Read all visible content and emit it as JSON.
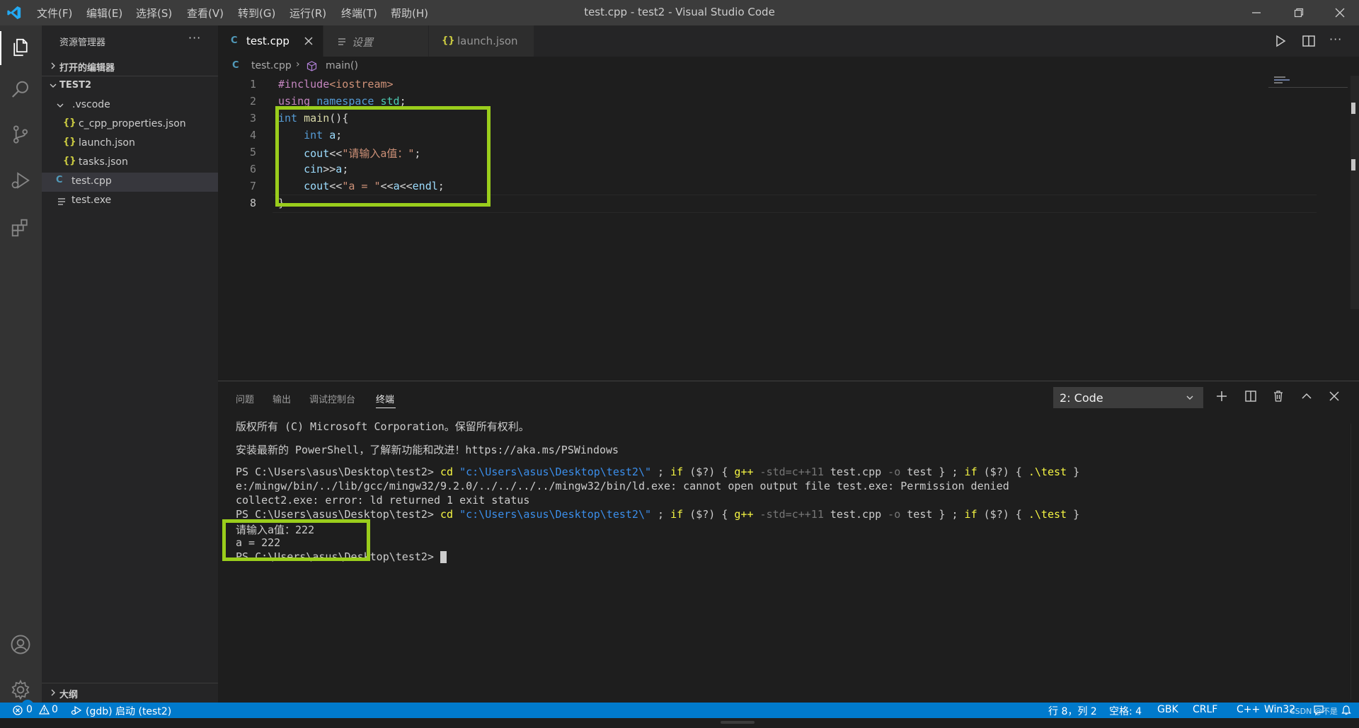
{
  "titlebar": {
    "menu": [
      "文件(F)",
      "编辑(E)",
      "选择(S)",
      "查看(V)",
      "转到(G)",
      "运行(R)",
      "终端(T)",
      "帮助(H)"
    ],
    "title": "test.cpp - test2 - Visual Studio Code"
  },
  "sidebar": {
    "header": "资源管理器",
    "more": "···",
    "open_editors": "打开的编辑器",
    "folder": "TEST2",
    "items": [
      {
        "label": ".vscode"
      },
      {
        "label": "c_cpp_properties.json"
      },
      {
        "label": "launch.json"
      },
      {
        "label": "tasks.json"
      },
      {
        "label": "test.cpp"
      },
      {
        "label": "test.exe"
      }
    ],
    "outline": "大纲"
  },
  "tabs": [
    {
      "label": "test.cpp"
    },
    {
      "label": "设置"
    },
    {
      "label": "launch.json"
    }
  ],
  "breadcrumb": {
    "file": "test.cpp",
    "symbol": "main()"
  },
  "code": {
    "line_numbers": [
      "1",
      "2",
      "3",
      "4",
      "5",
      "6",
      "7",
      "8"
    ],
    "lines": [
      [
        "#include",
        "<iostream>"
      ],
      [
        "using",
        " ",
        "namespace",
        " ",
        "std",
        ";"
      ],
      [
        "int",
        " ",
        "main",
        "()",
        "{"
      ],
      [
        "    ",
        "int",
        " ",
        "a",
        ";"
      ],
      [
        "    ",
        "cout",
        "<<",
        "\"请输入a值：\"",
        ";"
      ],
      [
        "    ",
        "cin",
        ">>",
        "a",
        ";"
      ],
      [
        "    ",
        "cout",
        "<<",
        "\"a = \"",
        "<<",
        "a",
        "<<",
        "endl",
        ";"
      ],
      [
        "}"
      ]
    ]
  },
  "panel": {
    "tabs": [
      "问题",
      "输出",
      "调试控制台",
      "终端"
    ],
    "terminal_select": "2: Code",
    "terminal": {
      "l1": "版权所有 (C) Microsoft Corporation。保留所有权利。",
      "l2": "安装最新的 PowerShell，了解新功能和改进！https://aka.ms/PSWindows",
      "prompt": "PS C:\\Users\\asus\\Desktop\\test2> ",
      "cmd_cd": "cd",
      "cmd_path": "\"c:\\Users\\asus\\Desktop\\test2\\\"",
      "cmd_semi": " ; ",
      "cmd_if": "if",
      "cmd_cond": " ($?) { ",
      "cmd_gpp": "g++",
      "cmd_std": "-std=c++11",
      "cmd_file": " test.cpp ",
      "cmd_o": "-o",
      "cmd_test": " test } ; ",
      "cmd_if2": "if",
      "cmd_cond2": " ($?) { ",
      "cmd_run": ".\\test",
      "cmd_end": " }",
      "err1": "e:/mingw/bin/../lib/gcc/mingw32/9.2.0/../../../../mingw32/bin/ld.exe: cannot open output file test.exe: Permission denied",
      "err2": "collect2.exe: error: ld returned 1 exit status",
      "out1": "请输入a值：222",
      "out2": "a = 222"
    }
  },
  "statusbar": {
    "errors": "0",
    "warnings": "0",
    "debug": "(gdb) 启动 (test2)",
    "position": "行 8，列 2",
    "spaces": "空格: 4",
    "encoding": "GBK",
    "eol": "CRLF",
    "language": "C++",
    "platform": "Win32",
    "watermark": "CSDN @不是"
  },
  "activity": {
    "badge": "1"
  },
  "colors": {
    "accent": "#007acc",
    "highlight": "#9acd1c"
  }
}
